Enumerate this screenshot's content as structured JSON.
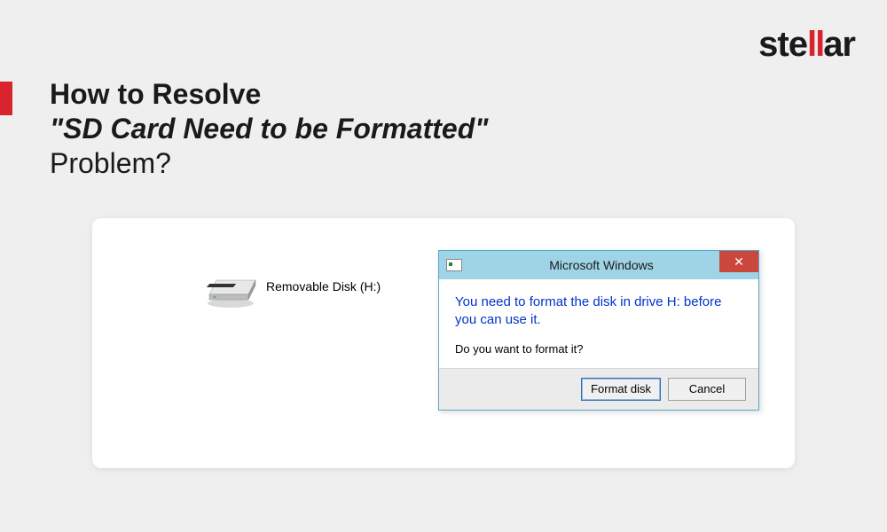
{
  "brand": {
    "pre": "ste",
    "mid": "ll",
    "post": "ar"
  },
  "heading": {
    "line1": "How to Resolve",
    "line2": "\"SD Card Need to be Formatted\"",
    "line3": "Problem?"
  },
  "disk": {
    "label": "Removable Disk (H:)"
  },
  "dialog": {
    "title": "Microsoft Windows",
    "main_text": "You need to format the disk in drive H: before you can use it.",
    "sub_text": "Do you want to format it?",
    "format_btn": "Format disk",
    "cancel_btn": "Cancel",
    "close_glyph": "✕"
  }
}
